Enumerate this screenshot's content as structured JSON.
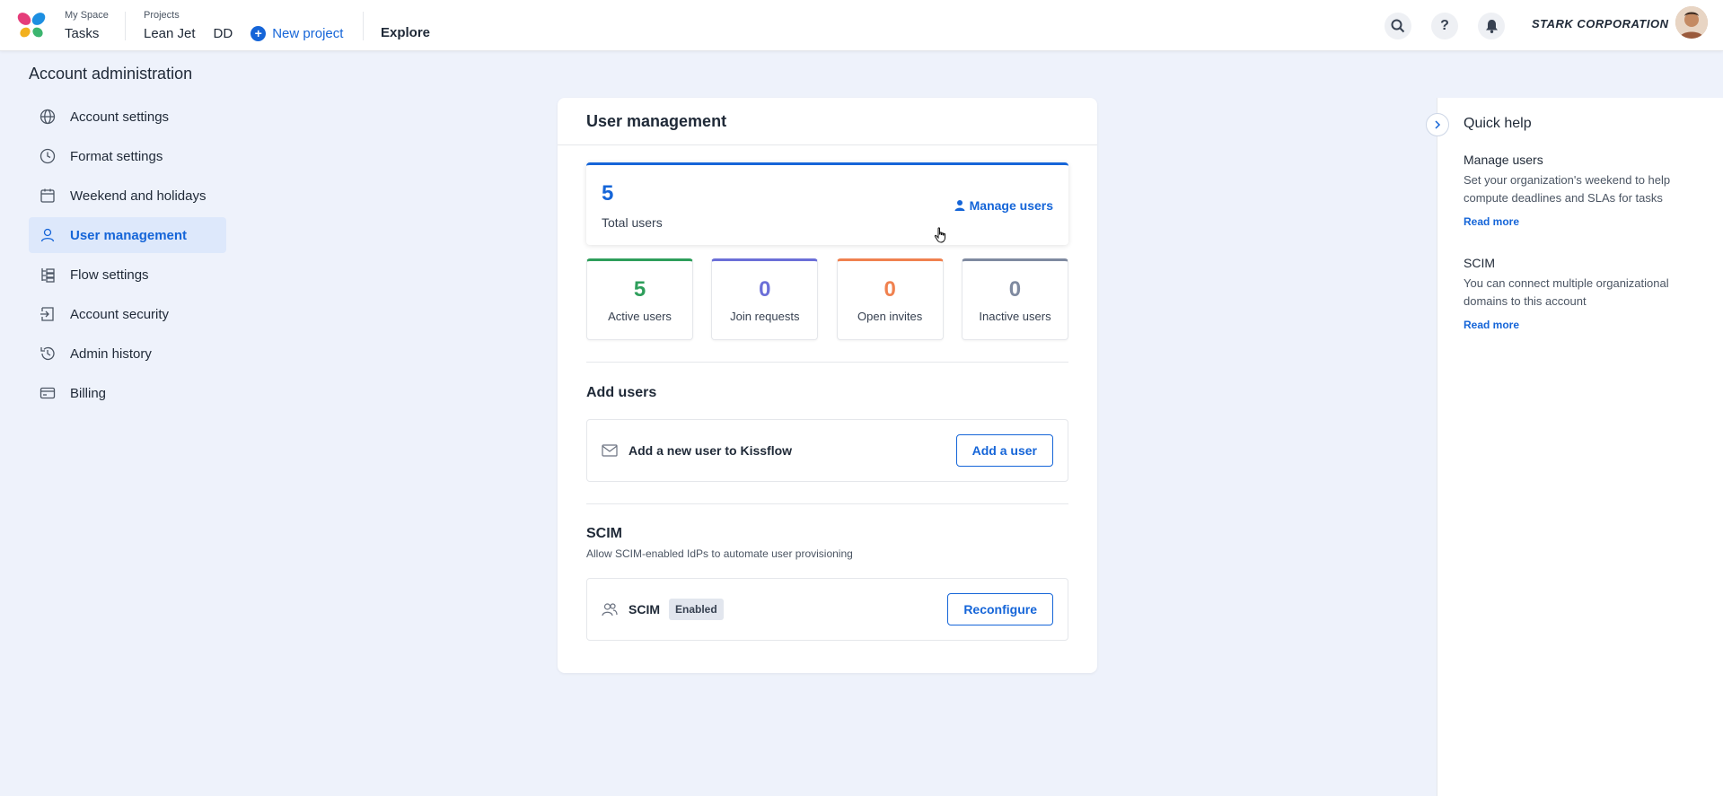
{
  "topbar": {
    "my_space_label": "My Space",
    "tasks_label": "Tasks",
    "projects_label": "Projects",
    "projects": [
      "Lean Jet",
      "DD"
    ],
    "new_project_label": "New project",
    "explore_label": "Explore",
    "brand": "STARK CORPORATION",
    "icons": [
      "search-icon",
      "help-icon",
      "bell-icon"
    ]
  },
  "sidebar": {
    "title": "Account administration",
    "items": [
      {
        "label": "Account settings",
        "icon": "globe-icon"
      },
      {
        "label": "Format settings",
        "icon": "clock-icon"
      },
      {
        "label": "Weekend and holidays",
        "icon": "calendar-icon"
      },
      {
        "label": "User management",
        "icon": "user-icon",
        "active": true
      },
      {
        "label": "Flow settings",
        "icon": "flow-icon"
      },
      {
        "label": "Account security",
        "icon": "login-icon"
      },
      {
        "label": "Admin history",
        "icon": "history-icon"
      },
      {
        "label": "Billing",
        "icon": "card-icon"
      }
    ]
  },
  "main": {
    "title": "User management",
    "total": {
      "value": "5",
      "label": "Total users",
      "manage_label": "Manage users"
    },
    "stats": [
      {
        "value": "5",
        "label": "Active users",
        "color": "#2e9e5b"
      },
      {
        "value": "0",
        "label": "Join requests",
        "color": "#6b6fd8"
      },
      {
        "value": "0",
        "label": "Open invites",
        "color": "#f0814f"
      },
      {
        "value": "0",
        "label": "Inactive users",
        "color": "#7f8aa0"
      }
    ],
    "add_users": {
      "title": "Add users",
      "row_text": "Add a new user to Kissflow",
      "button": "Add a user"
    },
    "scim": {
      "title": "SCIM",
      "subtitle": "Allow SCIM-enabled IdPs to automate user provisioning",
      "row_text": "SCIM",
      "badge": "Enabled",
      "button": "Reconfigure"
    }
  },
  "quick_help": {
    "title": "Quick help",
    "sections": [
      {
        "heading": "Manage users",
        "text": "Set your organization's weekend to help compute deadlines and SLAs for tasks",
        "link": "Read more"
      },
      {
        "heading": "SCIM",
        "text": "You can connect multiple organizational domains to this account",
        "link": "Read more"
      }
    ]
  },
  "colors": {
    "accent": "#1565d8",
    "background": "#eef2fb"
  }
}
